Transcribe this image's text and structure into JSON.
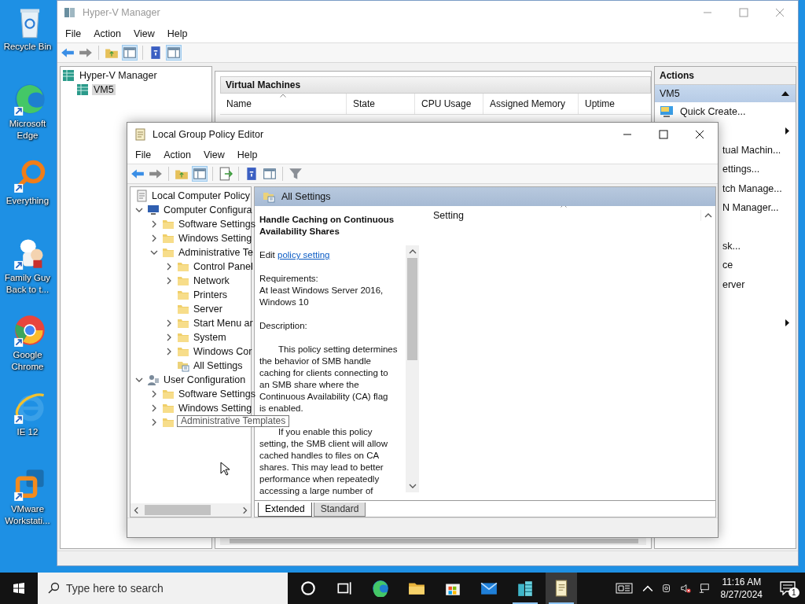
{
  "desktop_icons": [
    {
      "kind": "recycle",
      "label": "Recycle Bin"
    },
    {
      "kind": "edge",
      "label": "Microsoft Edge"
    },
    {
      "kind": "everything",
      "label": "Everything"
    },
    {
      "kind": "cartoon",
      "label": "Family Guy Back to t..."
    },
    {
      "kind": "chrome",
      "label": "Google Chrome"
    },
    {
      "kind": "ie",
      "label": "IE 12"
    },
    {
      "kind": "vmware",
      "label": "VMware Workstati..."
    }
  ],
  "hyperv": {
    "title": "Hyper-V Manager",
    "menu": [
      "File",
      "Action",
      "View",
      "Help"
    ],
    "tree": [
      {
        "label": "Hyper-V Manager",
        "selected": false,
        "children": [
          {
            "label": "VM5",
            "selected": true
          }
        ]
      }
    ],
    "vm_panel": {
      "title": "Virtual Machines",
      "columns": [
        {
          "label": "Name",
          "sorted": true
        },
        {
          "label": "State",
          "sorted": false
        },
        {
          "label": "CPU Usage",
          "sorted": false
        },
        {
          "label": "Assigned Memory",
          "sorted": false
        },
        {
          "label": "Uptime",
          "sorted": false
        }
      ]
    },
    "actions": {
      "title": "Actions",
      "group": "VM5",
      "expanded": true,
      "items": [
        {
          "kind": "icon",
          "label": "Quick Create..."
        },
        {
          "kind": "submenu"
        },
        {
          "kind": "cut",
          "label": "tual Machin..."
        },
        {
          "kind": "cut",
          "label": "ettings..."
        },
        {
          "kind": "cut",
          "label": "tch Manage..."
        },
        {
          "kind": "cut",
          "label": "N Manager..."
        },
        {
          "kind": "covered"
        },
        {
          "kind": "cut",
          "label": "sk..."
        },
        {
          "kind": "cut",
          "label": "ce"
        },
        {
          "kind": "cut",
          "label": "erver"
        },
        {
          "kind": "covered"
        },
        {
          "kind": "submenu"
        }
      ]
    }
  },
  "gpe": {
    "title": "Local Group Policy Editor",
    "menu": [
      "File",
      "Action",
      "View",
      "Help"
    ],
    "tree": [
      {
        "label": "Local Computer Policy",
        "kind": "policy",
        "children": [
          {
            "label": "Computer Configura",
            "kind": "computer",
            "expanded": true,
            "children": [
              {
                "label": "Software Settings",
                "kind": "folder",
                "expanded": false
              },
              {
                "label": "Windows Setting",
                "kind": "folder",
                "expanded": false
              },
              {
                "label": "Administrative Te",
                "kind": "folder",
                "expanded": true,
                "children": [
                  {
                    "label": "Control Panel",
                    "kind": "folder",
                    "expanded": false
                  },
                  {
                    "label": "Network",
                    "kind": "folder",
                    "expanded": false
                  },
                  {
                    "label": "Printers",
                    "kind": "folder"
                  },
                  {
                    "label": "Server",
                    "kind": "folder"
                  },
                  {
                    "label": "Start Menu ar",
                    "kind": "folder",
                    "expanded": false
                  },
                  {
                    "label": "System",
                    "kind": "folder",
                    "expanded": false
                  },
                  {
                    "label": "Windows Cor",
                    "kind": "folder",
                    "expanded": false
                  },
                  {
                    "label": "All Settings",
                    "kind": "settings"
                  }
                ]
              }
            ]
          },
          {
            "label": "User Configuration",
            "kind": "user",
            "expanded": true,
            "children": [
              {
                "label": "Software Settings",
                "kind": "folder",
                "expanded": false
              },
              {
                "label": "Windows Setting",
                "kind": "folder",
                "expanded": false
              },
              {
                "tooltip": "Administrative Templates",
                "kind": "folder",
                "expanded": false
              }
            ]
          }
        ]
      }
    ],
    "header": "All Settings",
    "detail": {
      "title": "Handle Caching on Continuous\nAvailability Shares",
      "edit": "Edit",
      "edit_link": "policy setting",
      "requirements_label": "Requirements:",
      "requirements": "At least Windows Server 2016,\nWindows 10",
      "description_label": "Description:",
      "paragraphs": [
        "This policy setting determines\nthe behavior of SMB handle\ncaching for clients connecting to\nan SMB share where the\nContinuous Availability (CA) flag\nis enabled.",
        "If you enable this policy\nsetting, the SMB client will allow\ncached handles to files on CA\nshares. This may lead to better\nperformance when repeatedly\naccessing a large number of"
      ]
    },
    "list": {
      "columns": [
        {
          "label": "Setting",
          "sorted": true
        }
      ]
    },
    "tabs": [
      {
        "label": "Extended",
        "selected": true
      },
      {
        "label": "Standard",
        "selected": false
      }
    ]
  },
  "taskbar": {
    "search": {
      "placeholder": "Type here to search"
    },
    "apps": [
      {
        "kind": "cortana",
        "running": false,
        "active": false
      },
      {
        "kind": "taskview",
        "running": false,
        "active": false
      },
      {
        "kind": "edge",
        "running": false,
        "active": false
      },
      {
        "kind": "explorer",
        "running": false,
        "active": false
      },
      {
        "kind": "store",
        "running": false,
        "active": false
      },
      {
        "kind": "mail",
        "running": false,
        "active": false
      },
      {
        "kind": "hyperv",
        "running": true,
        "active": false
      },
      {
        "kind": "gpe",
        "running": true,
        "active": true
      }
    ],
    "time": "11:16 AM",
    "date": "8/27/2024",
    "notifications": "1"
  }
}
